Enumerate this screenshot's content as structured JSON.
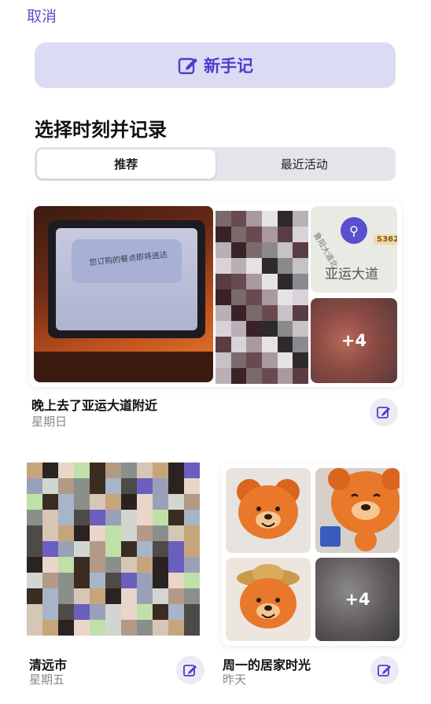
{
  "header": {
    "cancel_label": "取消"
  },
  "new_journal": {
    "label": "新手记",
    "icon": "compose-icon"
  },
  "section": {
    "title": "选择时刻并记录"
  },
  "tabs": [
    {
      "label": "推荐",
      "active": true
    },
    {
      "label": "最近活动",
      "active": false
    }
  ],
  "moments": [
    {
      "title": "晚上去了亚运大道附近",
      "date": "星期日",
      "photo_caption": "您订购的餐点即将送达",
      "map": {
        "place": "亚运大道",
        "route_badge": "S362",
        "street": "鲁阳大道北"
      },
      "more_count": "+4"
    },
    {
      "title": "清远市",
      "date": "星期五"
    },
    {
      "title": "周一的居家时光",
      "date": "昨天",
      "more_count": "+4"
    }
  ],
  "colors": {
    "accent": "#5a4fd0",
    "button_bg": "#dcdbf4"
  }
}
